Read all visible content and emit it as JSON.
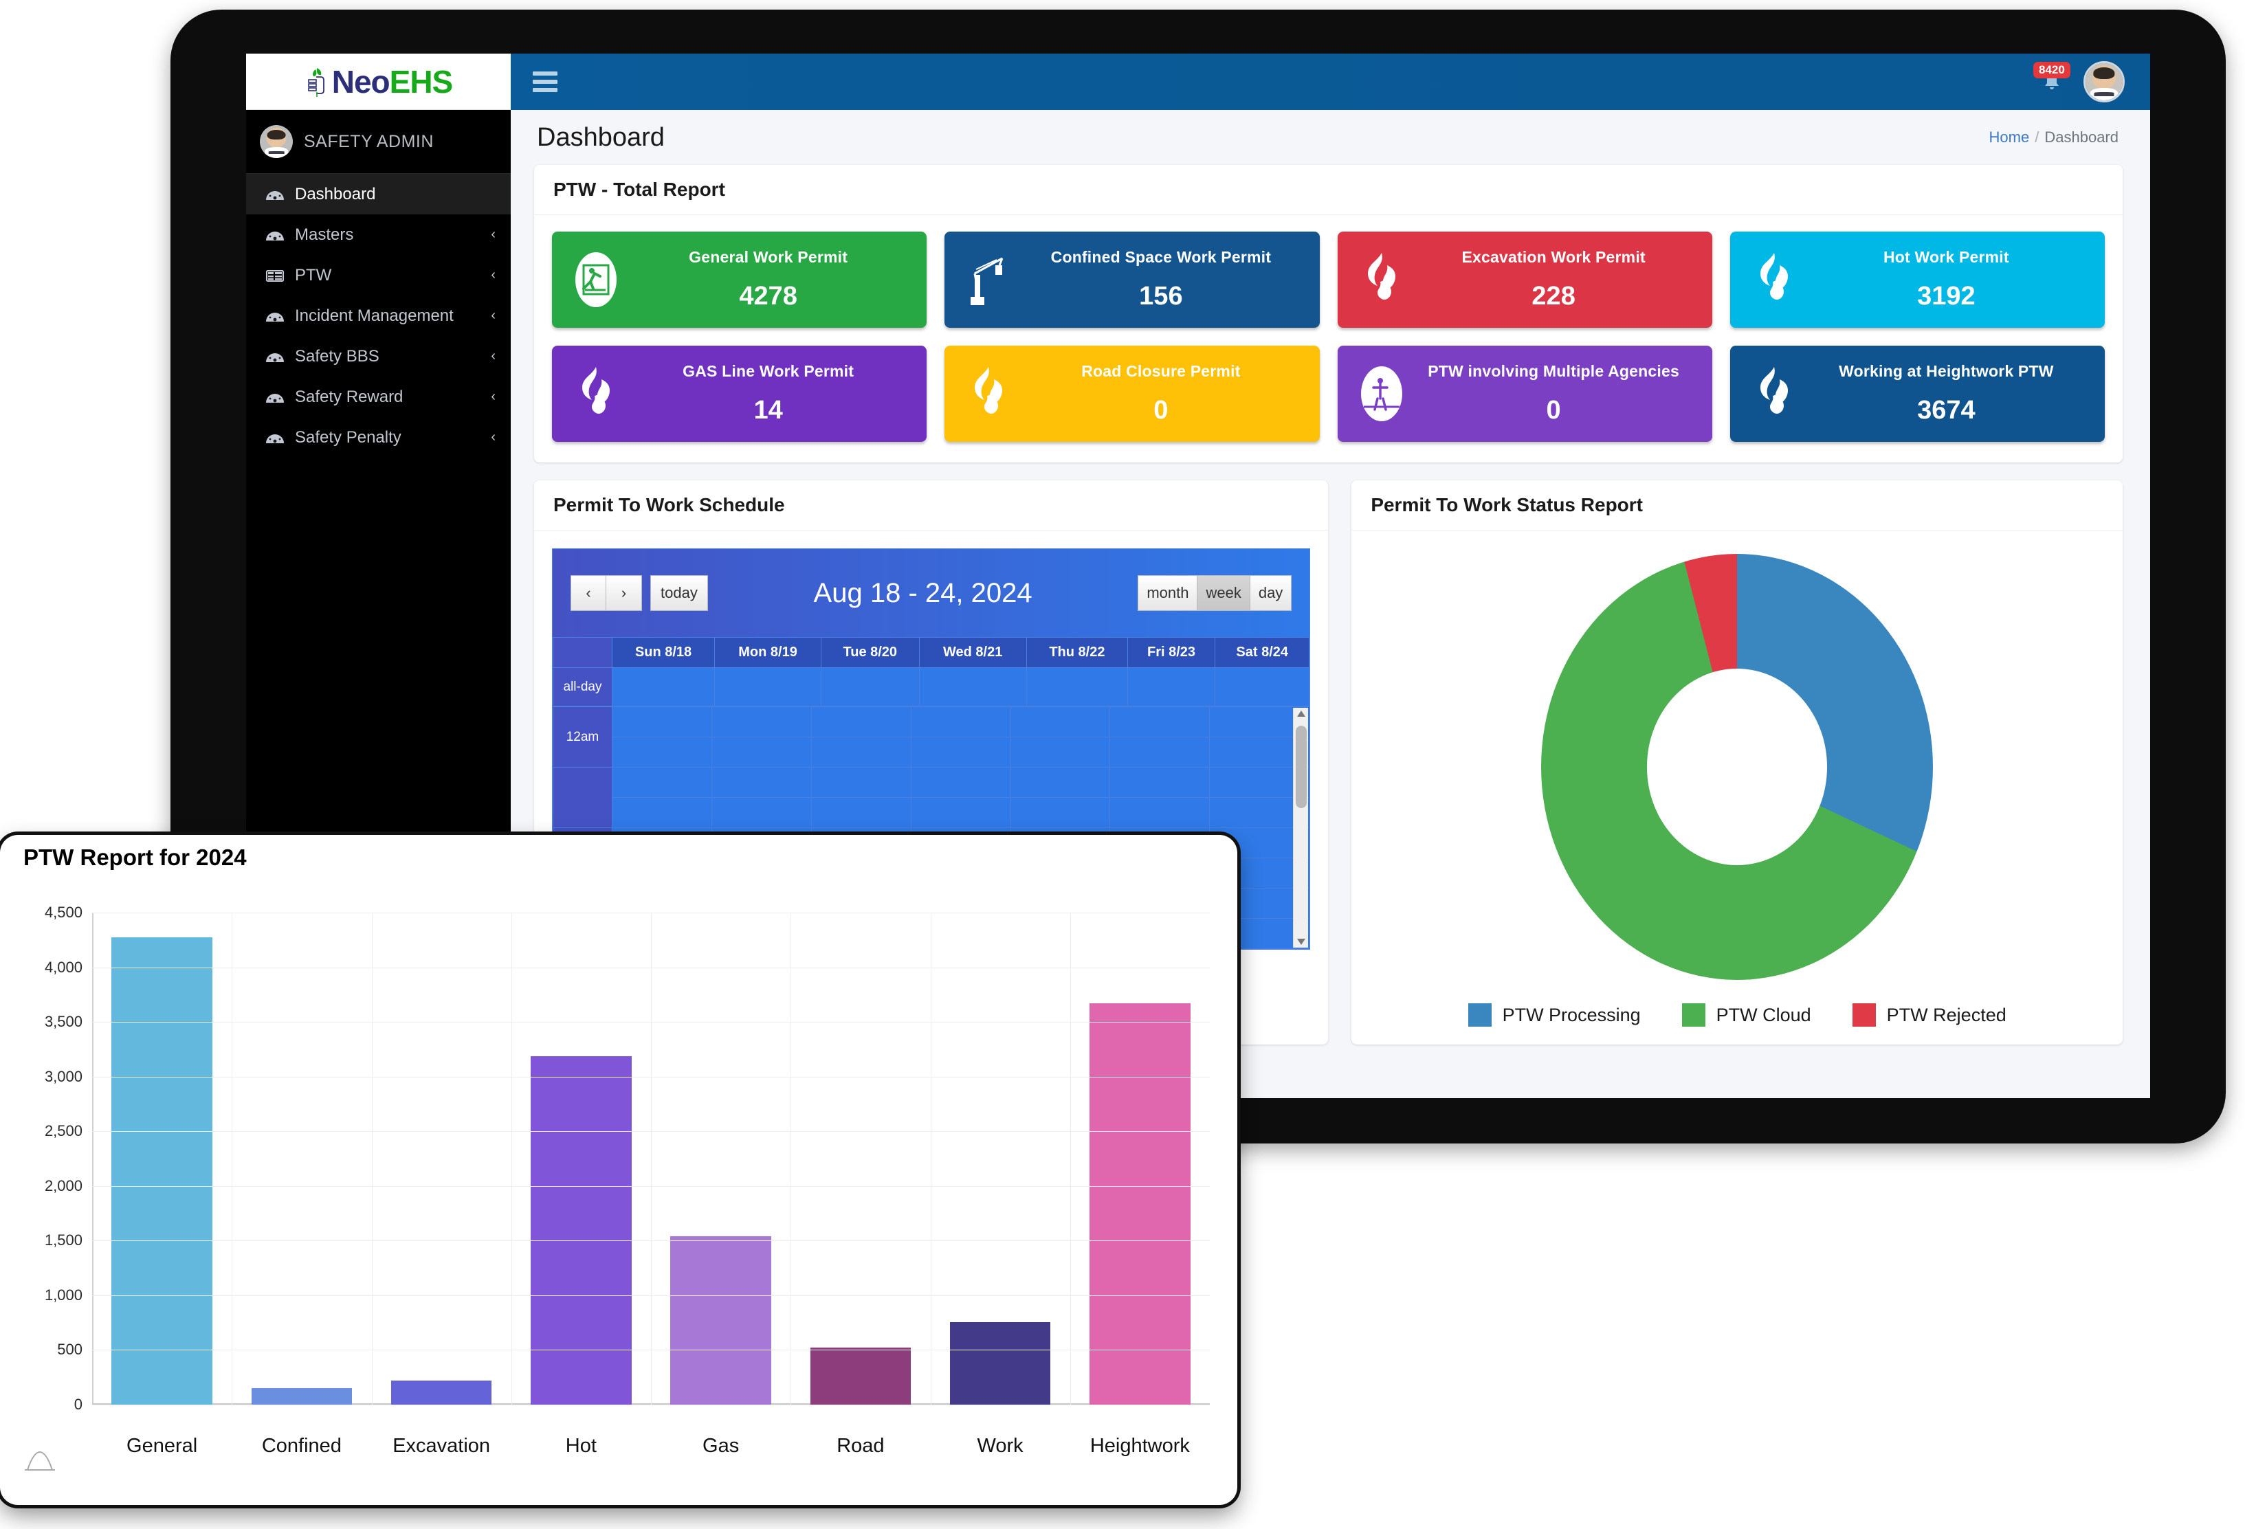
{
  "brand": {
    "name_first": "Neo",
    "name_second": "EHS"
  },
  "sidebar": {
    "user": "SAFETY ADMIN",
    "items": [
      {
        "label": "Dashboard",
        "icon": "speedometer-icon",
        "caret": "",
        "active": true
      },
      {
        "label": "Masters",
        "icon": "speedometer-icon",
        "caret": "‹",
        "active": false
      },
      {
        "label": "PTW",
        "icon": "table-icon",
        "caret": "‹",
        "active": false
      },
      {
        "label": "Incident Management",
        "icon": "speedometer-icon",
        "caret": "‹",
        "active": false
      },
      {
        "label": "Safety BBS",
        "icon": "speedometer-icon",
        "caret": "‹",
        "active": false
      },
      {
        "label": "Safety Reward",
        "icon": "speedometer-icon",
        "caret": "‹",
        "active": false
      },
      {
        "label": "Safety Penalty",
        "icon": "speedometer-icon",
        "caret": "‹",
        "active": false
      }
    ]
  },
  "topbar": {
    "notification_count": "8420"
  },
  "pagehead": {
    "title": "Dashboard",
    "breadcrumb_home": "Home",
    "breadcrumb_sep": "/",
    "breadcrumb_current": "Dashboard"
  },
  "ptw_total": {
    "title": "PTW - Total Report",
    "tiles": [
      {
        "label": "General Work Permit",
        "value": "4278",
        "color": "#28a745",
        "icon": "person-slip-hazard-icon"
      },
      {
        "label": "Confined Space Work Permit",
        "value": "156",
        "color": "#14558f",
        "icon": "crane-icon"
      },
      {
        "label": "Excavation Work Permit",
        "value": "228",
        "color": "#dc3545",
        "icon": "flame-icon"
      },
      {
        "label": "Hot Work Permit",
        "value": "3192",
        "color": "#00b8e6",
        "icon": "flame-icon"
      },
      {
        "label": "GAS Line Work Permit",
        "value": "14",
        "color": "#7030c0",
        "icon": "flame-icon"
      },
      {
        "label": "Road Closure Permit",
        "value": "0",
        "color": "#ffc107",
        "icon": "flame-icon"
      },
      {
        "label": "PTW involving Multiple Agencies",
        "value": "0",
        "color": "#7b3fc4",
        "icon": "confined-entry-icon"
      },
      {
        "label": "Working at Heightwork PTW",
        "value": "3674",
        "color": "#10548f",
        "icon": "flame-icon"
      }
    ]
  },
  "schedule": {
    "title": "Permit To Work Schedule",
    "prev_label": "‹",
    "next_label": "›",
    "today_label": "today",
    "range_title": "Aug 18 - 24, 2024",
    "views": [
      {
        "label": "month",
        "selected": false
      },
      {
        "label": "week",
        "selected": true
      },
      {
        "label": "day",
        "selected": false
      }
    ],
    "day_headers": [
      "Sun 8/18",
      "Mon 8/19",
      "Tue 8/20",
      "Wed 8/21",
      "Thu 8/22",
      "Fri 8/23",
      "Sat 8/24"
    ],
    "allday_label": "all-day",
    "time_slots": [
      "12am"
    ]
  },
  "status_report": {
    "title": "Permit To Work Status Report",
    "chart_data": {
      "type": "pie",
      "title": "Permit To Work Status Report",
      "labels": [
        "PTW Processing",
        "PTW Cloud",
        "PTW Rejected"
      ],
      "values": [
        32,
        64,
        4
      ],
      "colors": [
        "#3a87c0",
        "#4caf50",
        "#e03a46"
      ],
      "legend_position": "bottom",
      "donut": true
    }
  },
  "ptw_report_window": {
    "title": "PTW Report for 2024",
    "chart_data": {
      "type": "bar",
      "title": "PTW Report for 2024",
      "xlabel": "",
      "ylabel": "",
      "ylim": [
        0,
        4500
      ],
      "yticks": [
        0,
        500,
        1000,
        1500,
        2000,
        2500,
        3000,
        3500,
        4000,
        4500
      ],
      "ytick_labels": [
        "0",
        "500",
        "1,000",
        "1,500",
        "2,000",
        "2,500",
        "3,000",
        "3,500",
        "4,000",
        "4,500"
      ],
      "grid": true,
      "categories": [
        "General",
        "Confined",
        "Excavation",
        "Hot",
        "Gas",
        "Road",
        "Work",
        "Heightwork"
      ],
      "values": [
        4278,
        156,
        228,
        3192,
        1545,
        530,
        760,
        3674
      ],
      "colors": [
        "#62b9dd",
        "#6a8fe0",
        "#6464d8",
        "#8155d8",
        "#a878d6",
        "#8e3d7c",
        "#443a8a",
        "#e066ad"
      ]
    }
  }
}
